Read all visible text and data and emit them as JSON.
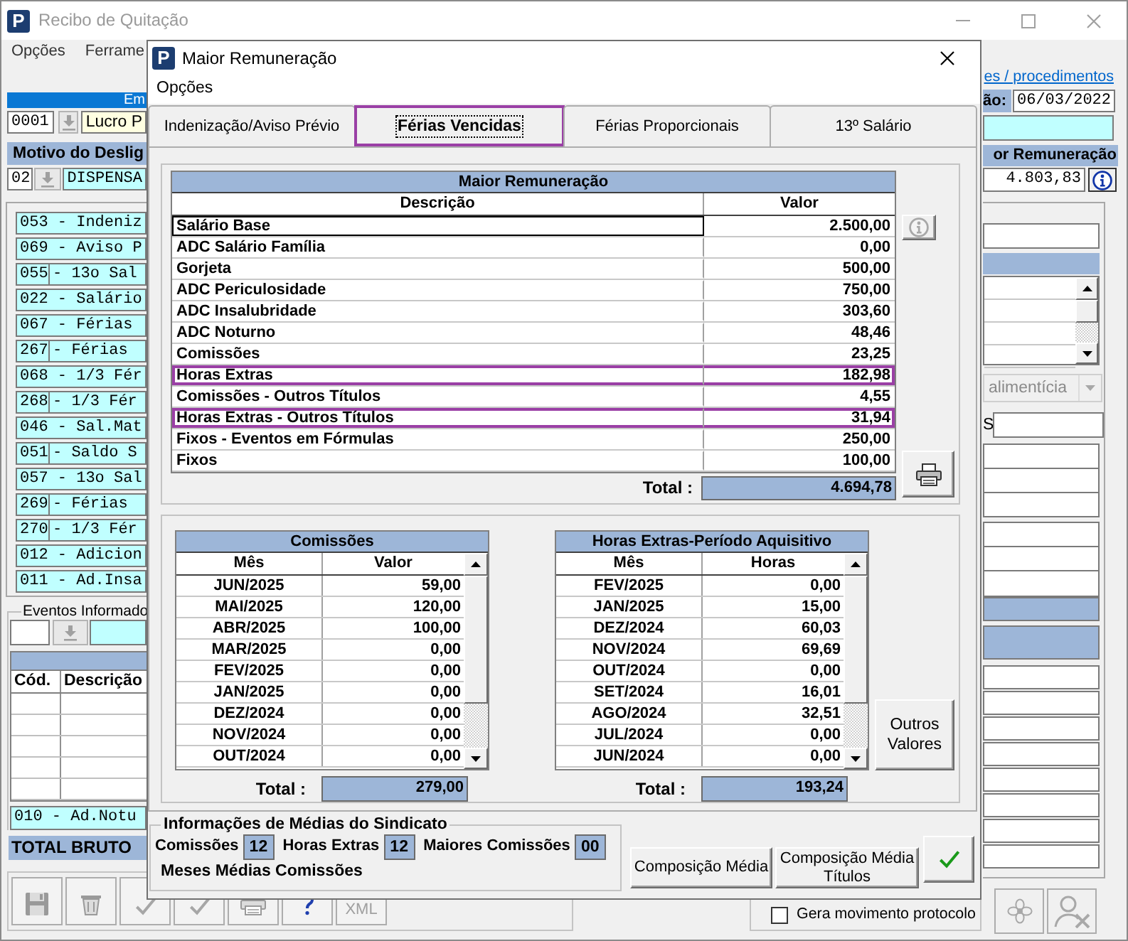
{
  "main_window": {
    "logo": "P",
    "title": "Recibo de Quitação",
    "menu": [
      "Opções",
      "Ferrame"
    ],
    "company": {
      "header": "Em",
      "code": "0001",
      "name": "Lucro P"
    },
    "reason": {
      "header": "Motivo do Deslig",
      "code": "02",
      "name": "DISPENSA"
    },
    "events": [
      {
        "kind": "single",
        "text": "053 - Indeniz"
      },
      {
        "kind": "single",
        "text": "069 - Aviso P"
      },
      {
        "kind": "split",
        "code": "055",
        "text": "- 13o Sal"
      },
      {
        "kind": "single",
        "text": "022 - Salário"
      },
      {
        "kind": "single",
        "text": "067 - Férias"
      },
      {
        "kind": "split",
        "code": "267",
        "text": "- Férias"
      },
      {
        "kind": "single",
        "text": "068 - 1/3 Fér"
      },
      {
        "kind": "split",
        "code": "268",
        "text": "- 1/3 Fér"
      },
      {
        "kind": "single",
        "text": "046 - Sal.Mat"
      },
      {
        "kind": "split",
        "code": "051",
        "text": "- Saldo S"
      },
      {
        "kind": "single",
        "text": "057 - 13o Sal"
      },
      {
        "kind": "split",
        "code": "269",
        "text": "- Férias"
      },
      {
        "kind": "split",
        "code": "270",
        "text": "- 1/3 Fér"
      },
      {
        "kind": "single",
        "text": "012 - Adicion"
      },
      {
        "kind": "single",
        "text": "011 - Ad.Insa"
      }
    ],
    "informed_events": {
      "legend": "Eventos Informado",
      "columns": [
        "Cód.",
        "Descrição"
      ]
    },
    "current_event": "010 - Ad.Notu",
    "total_label": "TOTAL BRUTO",
    "toolbar": [
      {
        "kind": "save",
        "disabled": true
      },
      {
        "kind": "trash",
        "disabled": true
      },
      {
        "kind": "check",
        "disabled": true
      },
      {
        "kind": "check",
        "disabled": true
      },
      {
        "kind": "print",
        "disabled": true
      },
      {
        "kind": "help",
        "disabled": false
      },
      {
        "kind": "text",
        "label": "XML",
        "disabled": true
      }
    ],
    "link": "es / procedimentos",
    "date_label": "ão:",
    "date": "06/03/2022",
    "remuneration_header": "or Remuneração",
    "remuneration_value": "4.803,83",
    "dropdown": {
      "text": "alimentícia",
      "disabled": true
    },
    "field_label": "S",
    "protocol_checkbox": {
      "label": "Gera movimento protocolo",
      "checked": false
    },
    "corner_buttons": [
      {
        "kind": "flower",
        "disabled": true
      },
      {
        "kind": "person",
        "disabled": true
      }
    ]
  },
  "dialog": {
    "logo": "P",
    "title": "Maior Remuneração",
    "menu": [
      "Opções"
    ],
    "tabs": [
      {
        "label": "Indenização/Aviso Prévio",
        "selected": false,
        "highlighted": false
      },
      {
        "label": "Férias Vencidas",
        "selected": true,
        "highlighted": true
      },
      {
        "label": "Férias Proporcionais",
        "selected": false,
        "highlighted": false
      },
      {
        "label": "13º Salário",
        "selected": false,
        "highlighted": false
      }
    ],
    "remuneration_grid": {
      "title": "Maior Remuneração",
      "columns": [
        "Descrição",
        "Valor"
      ],
      "rows": [
        {
          "description": "Salário Base",
          "value": "2.500,00",
          "focused": true,
          "highlighted": false
        },
        {
          "description": "ADC Salário Família",
          "value": "0,00",
          "focused": false,
          "highlighted": false
        },
        {
          "description": "Gorjeta",
          "value": "500,00",
          "focused": false,
          "highlighted": false
        },
        {
          "description": "ADC Periculosidade",
          "value": "750,00",
          "focused": false,
          "highlighted": false
        },
        {
          "description": "ADC Insalubridade",
          "value": "303,60",
          "focused": false,
          "highlighted": false
        },
        {
          "description": "ADC Noturno",
          "value": "48,46",
          "focused": false,
          "highlighted": false
        },
        {
          "description": "Comissões",
          "value": "23,25",
          "focused": false,
          "highlighted": false
        },
        {
          "description": "Horas Extras",
          "value": "182,98",
          "focused": false,
          "highlighted": true
        },
        {
          "description": "Comissões - Outros Títulos",
          "value": "4,55",
          "focused": false,
          "highlighted": false
        },
        {
          "description": "Horas Extras - Outros Títulos",
          "value": "31,94",
          "focused": false,
          "highlighted": true
        },
        {
          "description": "Fixos - Eventos em Fórmulas",
          "value": "250,00",
          "focused": false,
          "highlighted": false
        },
        {
          "description": "Fixos",
          "value": "100,00",
          "focused": false,
          "highlighted": false
        }
      ],
      "total_label": "Total :",
      "total": "4.694,78"
    },
    "commissions_grid": {
      "title": "Comissões",
      "columns": [
        "Mês",
        "Valor"
      ],
      "rows": [
        {
          "month": "JUN/2025",
          "value": "59,00"
        },
        {
          "month": "MAI/2025",
          "value": "120,00"
        },
        {
          "month": "ABR/2025",
          "value": "100,00"
        },
        {
          "month": "MAR/2025",
          "value": "0,00"
        },
        {
          "month": "FEV/2025",
          "value": "0,00"
        },
        {
          "month": "JAN/2025",
          "value": "0,00"
        },
        {
          "month": "DEZ/2024",
          "value": "0,00"
        },
        {
          "month": "NOV/2024",
          "value": "0,00"
        },
        {
          "month": "OUT/2024",
          "value": "0,00"
        }
      ],
      "total_label": "Total :",
      "total": "279,00"
    },
    "overtime_grid": {
      "title": "Horas Extras-Período Aquisitivo",
      "columns": [
        "Mês",
        "Horas"
      ],
      "rows": [
        {
          "month": "FEV/2025",
          "hours": "0,00"
        },
        {
          "month": "JAN/2025",
          "hours": "15,00"
        },
        {
          "month": "DEZ/2024",
          "hours": "60,03"
        },
        {
          "month": "NOV/2024",
          "hours": "69,69"
        },
        {
          "month": "OUT/2024",
          "hours": "0,00"
        },
        {
          "month": "SET/2024",
          "hours": "16,01"
        },
        {
          "month": "AGO/2024",
          "hours": "32,51"
        },
        {
          "month": "JUL/2024",
          "hours": "0,00"
        },
        {
          "month": "JUN/2024",
          "hours": "0,00"
        }
      ],
      "total_label": "Total :",
      "total": "193,24"
    },
    "other_values_button": "Outros Valores",
    "union_averages": {
      "legend": "Informações de Médias do Sindicato",
      "fields": [
        {
          "label": "Comissões",
          "value": "12"
        },
        {
          "label": "Horas Extras",
          "value": "12"
        },
        {
          "label": "Maiores Comissões",
          "value": "00"
        }
      ],
      "months_label": "Meses Médias Comissões"
    },
    "buttons": [
      "Composição Média",
      "Composição Média Títulos"
    ]
  }
}
